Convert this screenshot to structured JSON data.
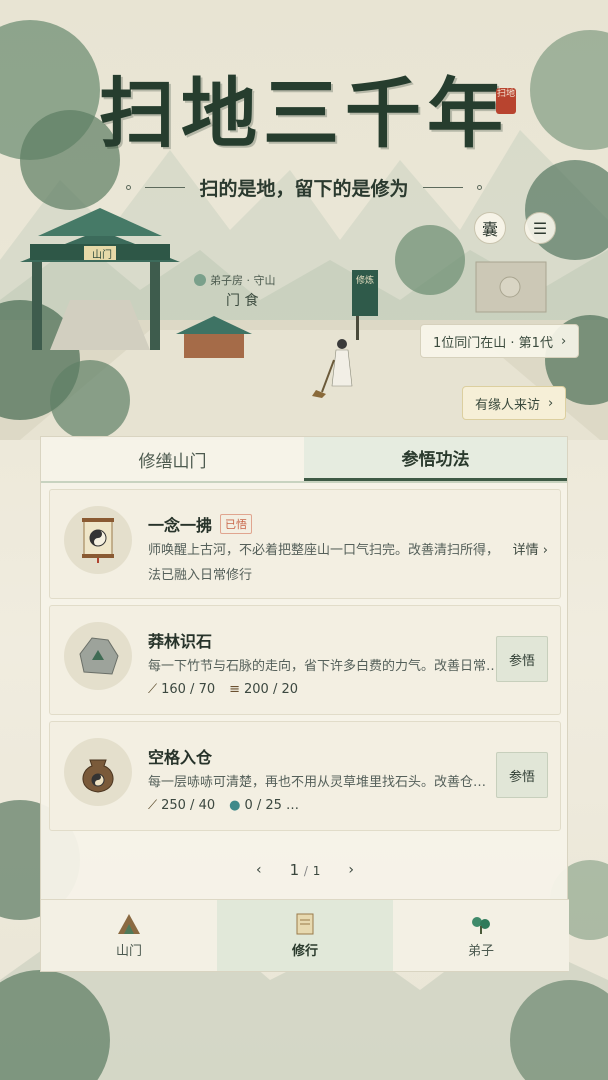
{
  "header": {
    "title": "扫地三千年",
    "seal": "扫地",
    "subtitle": "扫的是地，留下的是修为",
    "bag_button": "囊",
    "menu_button": "☰"
  },
  "scene": {
    "gate_sign": "山门",
    "sect_name": "弟子房 · 守山",
    "sect_sub": "门 食",
    "banner": "修炼"
  },
  "disciples_pill": {
    "label": "1位同门在山 · 第1代",
    "arrow": "›"
  },
  "visitor_pill": {
    "label": "有缘人来访",
    "arrow": "›"
  },
  "tabs": [
    {
      "label": "修缮山门",
      "active": false
    },
    {
      "label": "参悟功法",
      "active": true
    }
  ],
  "cards": [
    {
      "title": "一念一拂",
      "badge": "已悟",
      "desc": "师唤醒上古河，不必着把整座山一口气扫完。改善清扫所得，法已融入日常修行",
      "detail_label": "详情 ›",
      "icon": "scroll-icon"
    },
    {
      "title": "莽林识石",
      "desc": "每一下竹节与石脉的走向，省下许多白费的力气。改善日常生…",
      "costs": [
        {
          "icon": "broom-icon",
          "value": "160 / 70"
        },
        {
          "icon": "wood-icon",
          "value": "200 / 20"
        }
      ],
      "action": "参悟",
      "icon": "stone-icon"
    },
    {
      "title": "空格入仓",
      "desc": "每一层哧哧可清楚，再也不用从灵草堆里找石头。改善仓…",
      "costs": [
        {
          "icon": "broom-icon",
          "value": "250 / 40"
        },
        {
          "icon": "water-drop-icon",
          "value": "0 / 25 …"
        }
      ],
      "action": "参悟",
      "icon": "pouch-icon"
    }
  ],
  "pager": {
    "prev": "‹",
    "current": "1",
    "separator": "/",
    "total": "1",
    "next": "›"
  },
  "bottom_nav": [
    {
      "label": "山门",
      "icon": "gate-icon",
      "active": false
    },
    {
      "label": "修行",
      "icon": "scroll-icon",
      "active": true
    },
    {
      "label": "弟子",
      "icon": "herb-icon",
      "active": false
    }
  ]
}
